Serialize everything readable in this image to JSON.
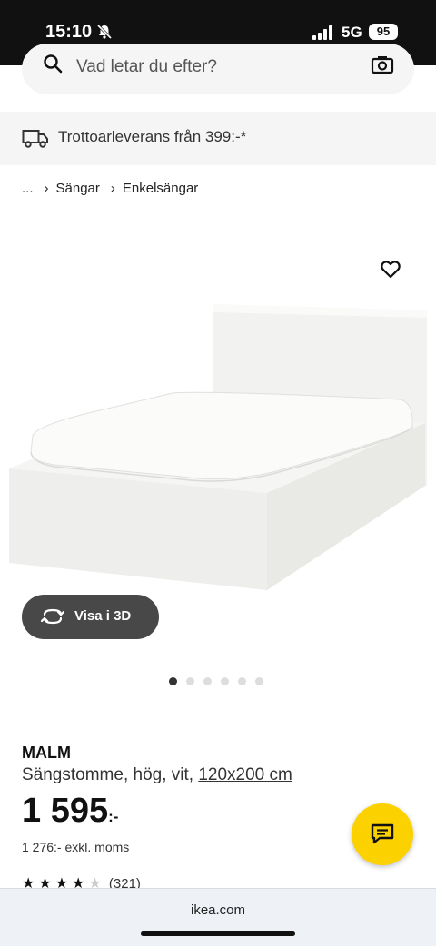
{
  "status_bar": {
    "time": "15:10",
    "network": "5G",
    "battery": "95"
  },
  "search": {
    "placeholder": "Vad letar du efter?"
  },
  "delivery": {
    "text": "Trottoarleverans från 399:-*"
  },
  "breadcrumb": {
    "items": [
      "...",
      "Sängar",
      "Enkelsängar"
    ]
  },
  "gallery": {
    "view_3d_label": "Visa i 3D",
    "image_count": 6,
    "active_index": 0
  },
  "product": {
    "name": "MALM",
    "description": "Sängstomme, hög, vit, ",
    "size": "120x200 cm",
    "price": "1 595",
    "price_suffix": ":-",
    "price_excl": "1 276:- exkl. moms",
    "rating_value": 4,
    "rating_max": 5,
    "review_count": "(321)"
  },
  "browser": {
    "url": "ikea.com"
  },
  "colors": {
    "chat_button": "#fcd100",
    "button_3d": "#484848"
  },
  "icons": [
    "bell-muted-icon",
    "signal-icon",
    "search-icon",
    "camera-icon",
    "truck-icon",
    "heart-icon",
    "rotate-3d-icon",
    "chat-icon"
  ]
}
